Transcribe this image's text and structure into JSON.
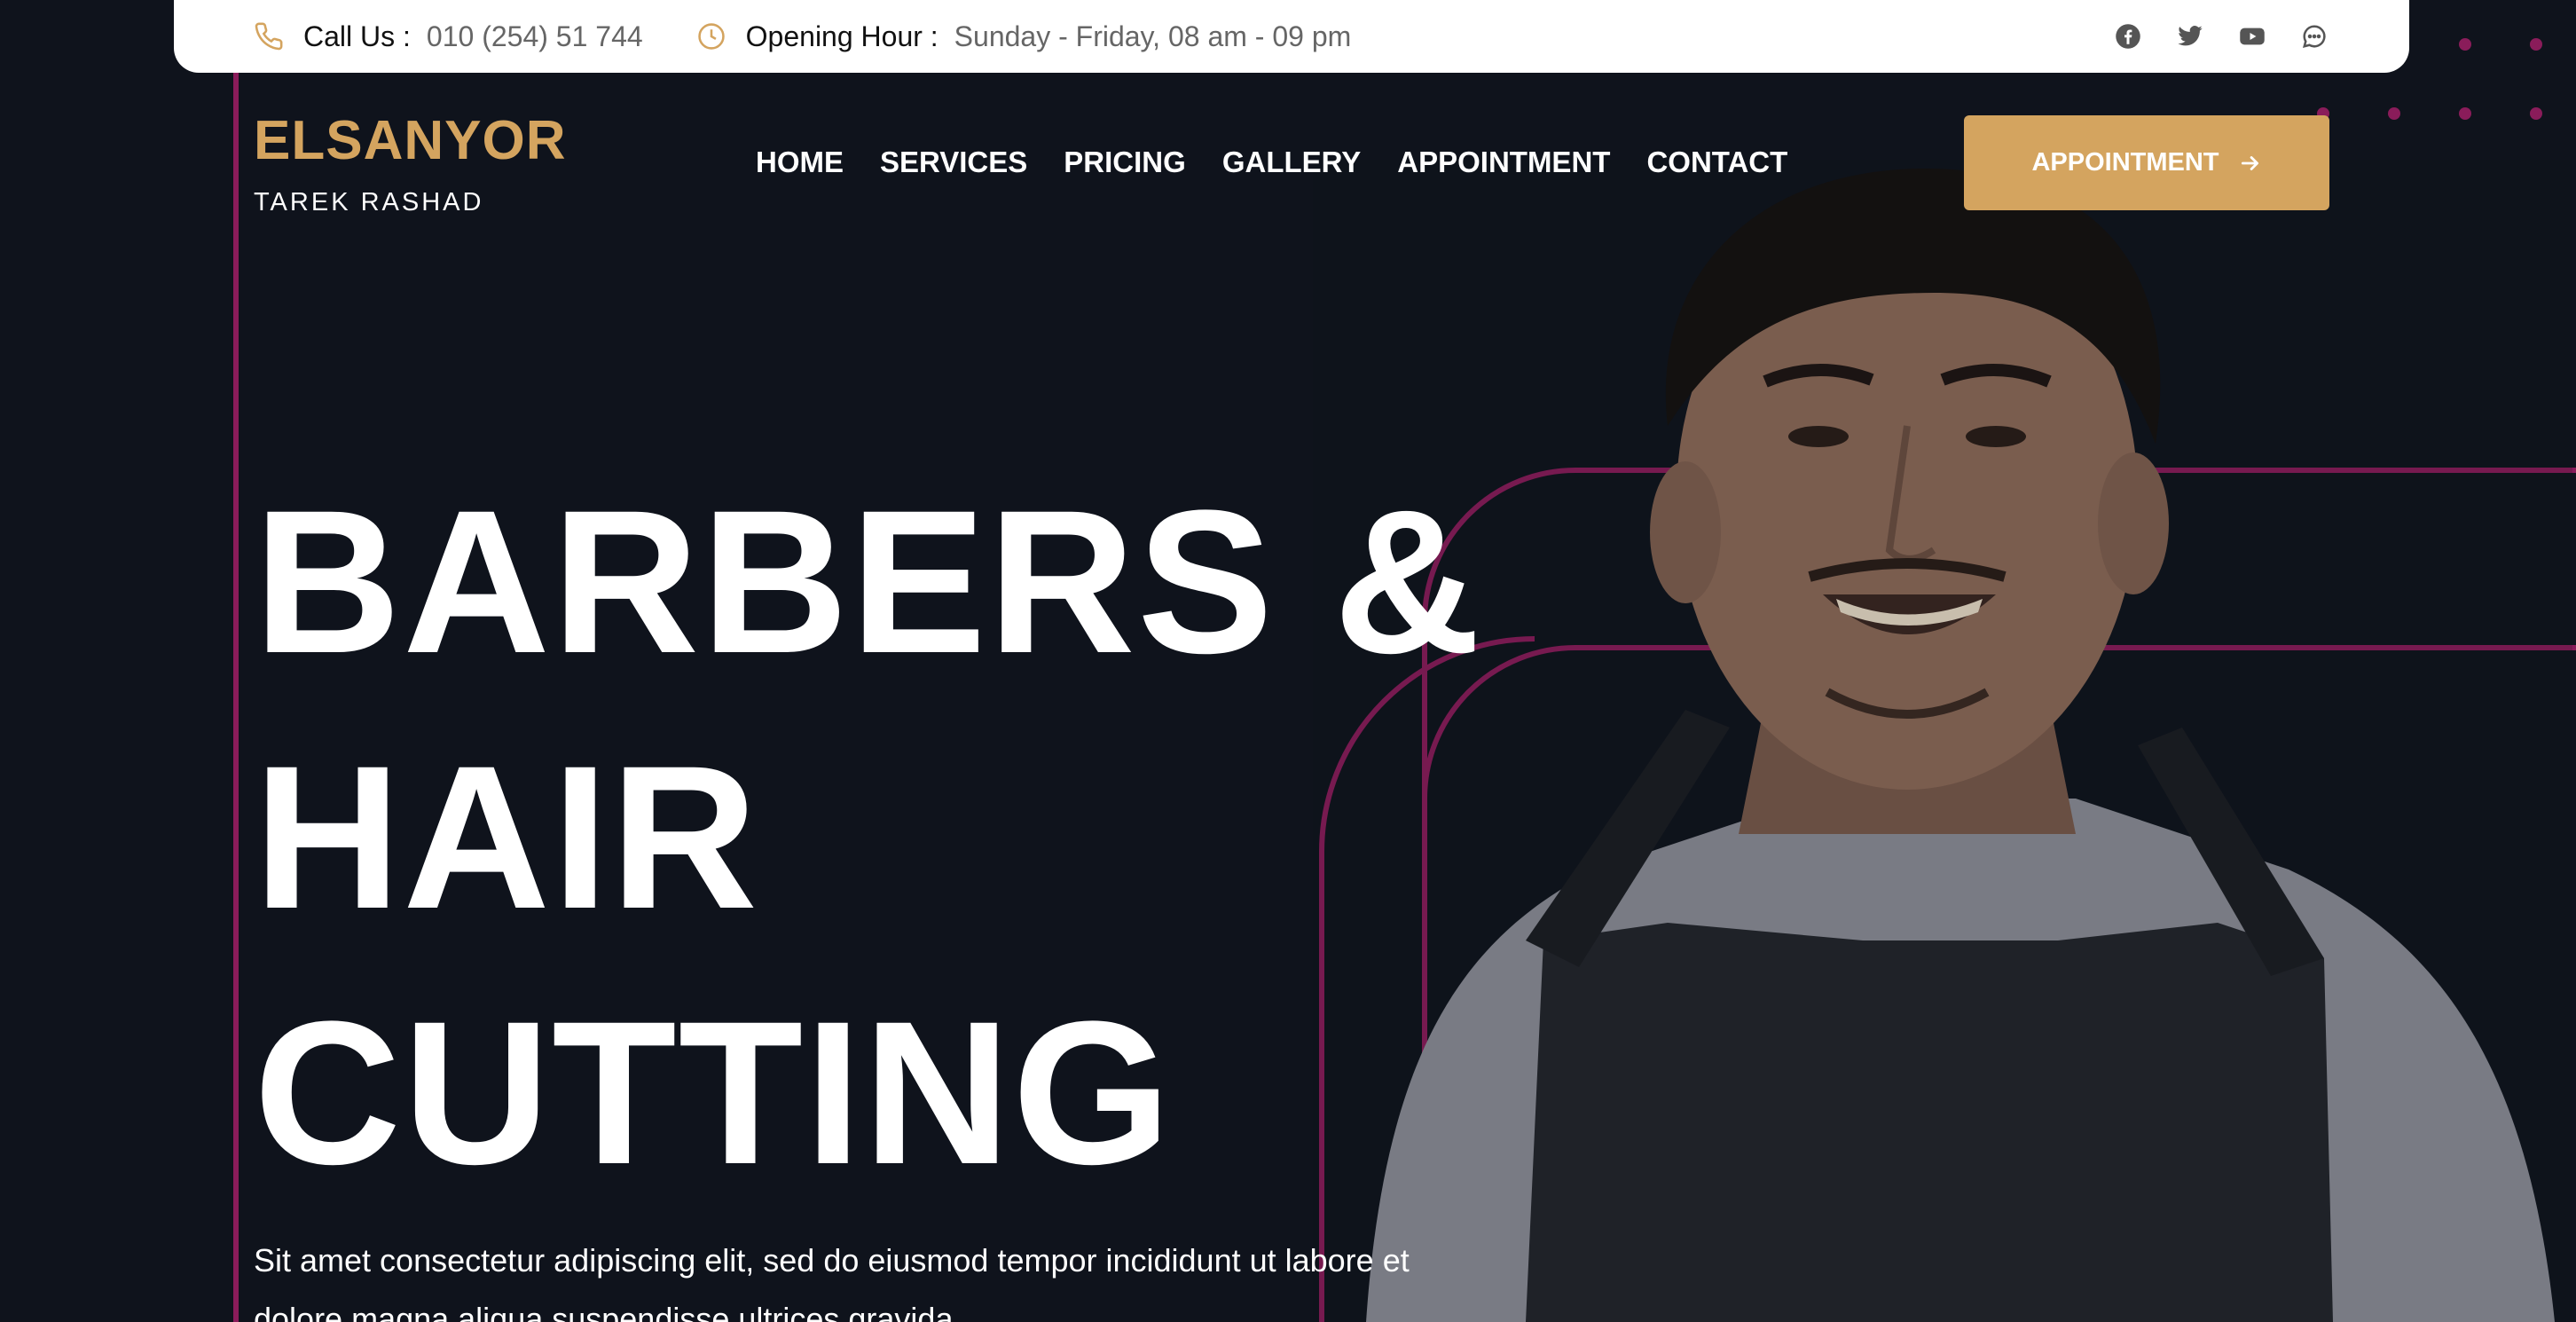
{
  "topbar": {
    "call_label": "Call Us :",
    "call_value": "010 (254) 51 744",
    "hours_label": "Opening Hour :",
    "hours_value": "Sunday - Friday, 08 am - 09 pm",
    "socials": [
      "facebook-icon",
      "twitter-icon",
      "youtube-icon",
      "chat-icon"
    ]
  },
  "brand": {
    "name": "ELSANYOR",
    "tagline": "TAREK RASHAD"
  },
  "nav": {
    "items": [
      "HOME",
      "SERVICES",
      "PRICING",
      "GALLERY",
      "APPOINTMENT",
      "CONTACT"
    ]
  },
  "cta": {
    "label": "APPOINTMENT"
  },
  "hero": {
    "title_lines": [
      "BARBERS &",
      "HAIR",
      "CUTTING"
    ],
    "description": "Sit amet consectetur adipiscing elit, sed do eiusmod tempor incididunt ut labore et dolore magna aliqua suspendisse ultrices gravida."
  },
  "colors": {
    "background": "#0f131c",
    "accent_gold": "#d4a45f",
    "accent_magenta": "#8a1c5a"
  }
}
